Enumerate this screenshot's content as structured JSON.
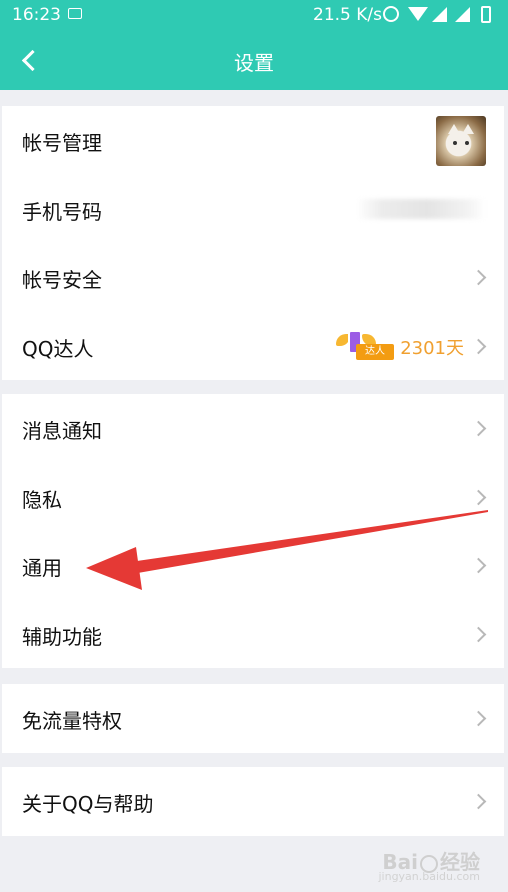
{
  "status_bar": {
    "time": "16:23",
    "network_speed": "21.5 K/s",
    "icons": [
      "image-icon",
      "alarm-icon",
      "wifi-icon",
      "signal-icon",
      "signal-icon",
      "battery-icon"
    ]
  },
  "header": {
    "title": "设置",
    "back_icon": "chevron-left-icon",
    "color": "#2fcab3"
  },
  "groups": [
    {
      "items": [
        {
          "label": "帐号管理",
          "trailing": "avatar"
        },
        {
          "label": "手机号码",
          "trailing": "redacted"
        },
        {
          "label": "帐号安全",
          "trailing": "chevron"
        },
        {
          "label": "QQ达人",
          "trailing": "badge",
          "badge_text": "达人",
          "days": "2301天"
        }
      ]
    },
    {
      "items": [
        {
          "label": "消息通知",
          "trailing": "chevron"
        },
        {
          "label": "隐私",
          "trailing": "chevron"
        },
        {
          "label": "通用",
          "trailing": "chevron"
        },
        {
          "label": "辅助功能",
          "trailing": "chevron"
        }
      ]
    },
    {
      "items": [
        {
          "label": "免流量特权",
          "trailing": "chevron"
        }
      ]
    },
    {
      "items": [
        {
          "label": "关于QQ与帮助",
          "trailing": "chevron"
        }
      ]
    }
  ],
  "annotation": {
    "type": "arrow",
    "color": "#e53935",
    "points_to": "通用"
  },
  "watermark": {
    "text": "Bai",
    "text2": "经验",
    "subtext": "jingyan.baidu.com"
  }
}
